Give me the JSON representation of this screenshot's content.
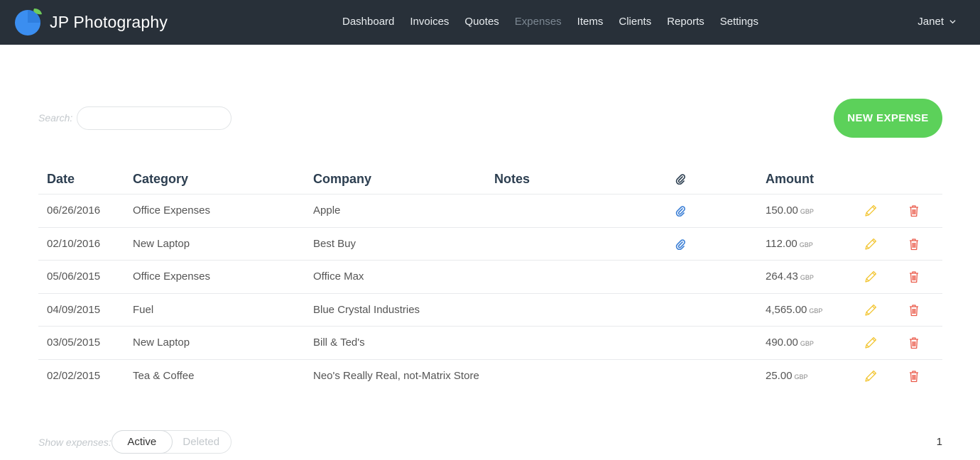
{
  "brand": {
    "name": "JP Photography",
    "logo_colors": {
      "primary": "#3b8ef0",
      "leaf": "#6ecb5a"
    }
  },
  "nav": {
    "items": [
      {
        "label": "Dashboard",
        "active": false
      },
      {
        "label": "Invoices",
        "active": false
      },
      {
        "label": "Quotes",
        "active": false
      },
      {
        "label": "Expenses",
        "active": true
      },
      {
        "label": "Items",
        "active": false
      },
      {
        "label": "Clients",
        "active": false
      },
      {
        "label": "Reports",
        "active": false
      },
      {
        "label": "Settings",
        "active": false
      }
    ]
  },
  "user": {
    "name": "Janet",
    "icon": "chevron-down-icon"
  },
  "search": {
    "label": "Search:",
    "value": "",
    "placeholder": ""
  },
  "new_expense": {
    "label": "NEW EXPENSE",
    "color": "#5cd15a"
  },
  "table": {
    "headers": {
      "date": "Date",
      "category": "Category",
      "company": "Company",
      "notes": "Notes",
      "attachment_icon": "paperclip-icon",
      "amount": "Amount"
    },
    "rows": [
      {
        "date": "06/26/2016",
        "category": "Office Expenses",
        "company": "Apple",
        "notes": "",
        "attachment": true,
        "amount": "150.00",
        "currency": "GBP"
      },
      {
        "date": "02/10/2016",
        "category": "New Laptop",
        "company": "Best Buy",
        "notes": "",
        "attachment": true,
        "amount": "112.00",
        "currency": "GBP"
      },
      {
        "date": "05/06/2015",
        "category": "Office Expenses",
        "company": "Office Max",
        "notes": "",
        "attachment": false,
        "amount": "264.43",
        "currency": "GBP"
      },
      {
        "date": "04/09/2015",
        "category": "Fuel",
        "company": "Blue Crystal Industries",
        "notes": "",
        "attachment": false,
        "amount": "4,565.00",
        "currency": "GBP"
      },
      {
        "date": "03/05/2015",
        "category": "New Laptop",
        "company": "Bill & Ted's",
        "notes": "",
        "attachment": false,
        "amount": "490.00",
        "currency": "GBP"
      },
      {
        "date": "02/02/2015",
        "category": "Tea & Coffee",
        "company": "Neo's Really Real, not-Matrix Store",
        "notes": "",
        "attachment": false,
        "amount": "25.00",
        "currency": "GBP"
      }
    ],
    "row_icons": {
      "edit": "pencil-icon",
      "delete": "trash-icon",
      "edit_color": "#f2c42e",
      "delete_color": "#ea5b4a",
      "attachment_color": "#3b7fd6"
    }
  },
  "footer": {
    "show_label": "Show expenses:",
    "options": [
      {
        "label": "Active",
        "selected": true
      },
      {
        "label": "Deleted",
        "selected": false
      }
    ],
    "page": "1"
  }
}
